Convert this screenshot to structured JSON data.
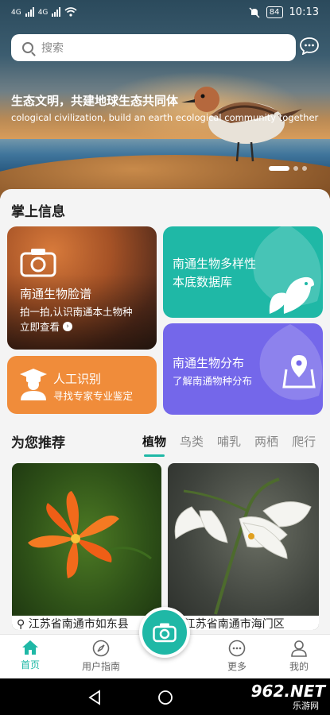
{
  "status_bar": {
    "network_1": "4G",
    "network_2": "4G",
    "battery": "84",
    "time": "10:13"
  },
  "search": {
    "placeholder": "搜索"
  },
  "banner": {
    "headline": "生态文明，共建地球生态共同体",
    "subline": "cological civilization, build an earth ecological community together",
    "page_count": 3,
    "active_page": 1
  },
  "section_info": {
    "title": "掌上信息"
  },
  "cards": {
    "face": {
      "title": "南通生物脸谱",
      "desc": "拍一拍,认识南通本土物种",
      "action": "立即查看"
    },
    "ai": {
      "title": "人工识别",
      "desc": "寻找专家专业鉴定"
    },
    "bio": {
      "line1": "南通生物多样性",
      "line2": "本底数据库"
    },
    "dist": {
      "title": "南通生物分布",
      "desc": "了解南通物种分布"
    }
  },
  "recommend": {
    "title": "为您推荐",
    "tabs": [
      "植物",
      "鸟类",
      "哺乳",
      "两栖",
      "爬行"
    ],
    "active_tab": 0,
    "items": [
      {
        "location": "江苏省南通市如东县"
      },
      {
        "location": "江苏省南通市海门区"
      }
    ]
  },
  "bottom_nav": {
    "home": "首页",
    "guide": "用户指南",
    "more": "更多",
    "mine": "我的"
  },
  "watermark": {
    "brand": "962.NET",
    "sub": "乐游网"
  },
  "colors": {
    "accent": "#1fb8a6",
    "purple": "#7467ea",
    "orange": "#f08c3a"
  },
  "icons": [
    "search-icon",
    "message-icon",
    "camera-icon",
    "leaf-bird-icon",
    "map-pin-icon",
    "expert-icon",
    "home-icon",
    "compass-icon",
    "more-icon",
    "user-icon"
  ]
}
